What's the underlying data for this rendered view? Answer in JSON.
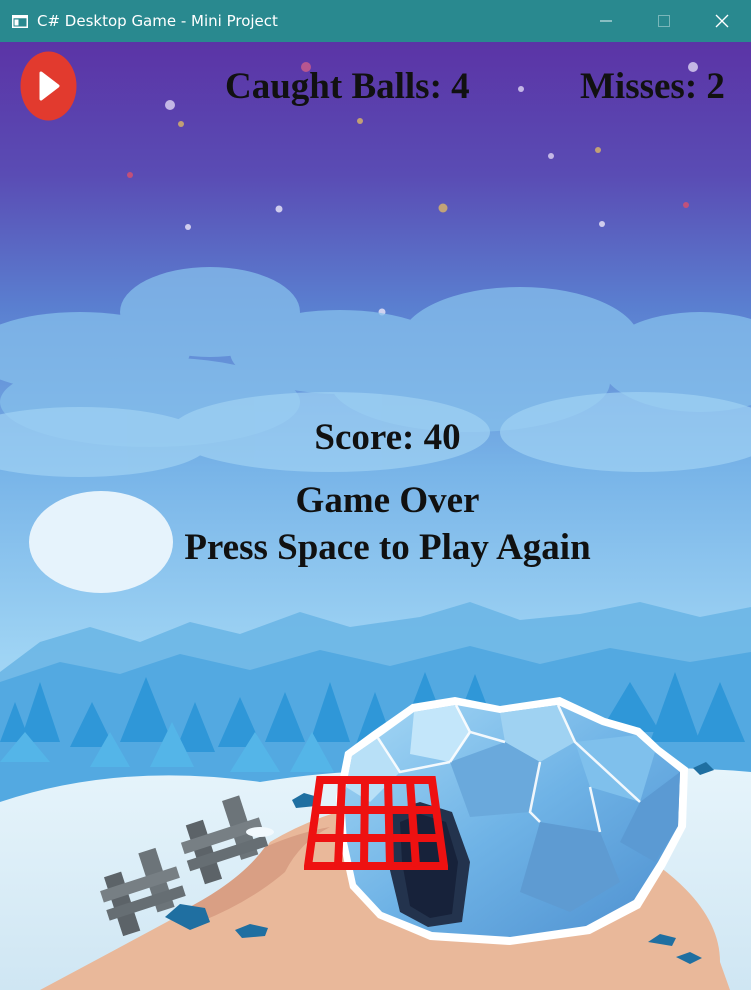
{
  "window": {
    "title": "C# Desktop Game - Mini Project",
    "titlebar_color": "#29898f",
    "controls": [
      "minimize-icon",
      "maximize-icon",
      "close-icon"
    ]
  },
  "hud": {
    "caught_balls_text": "Caught Balls: 4",
    "misses_text": "Misses: 2",
    "play_button_icon": "play-icon",
    "play_button_color": "#e23a2e"
  },
  "game_over": {
    "score_text": "Score: 40",
    "title_text": "Game Over",
    "prompt_text": "Press Space to Play Again"
  },
  "basket": {
    "icon": "basket-icon",
    "color": "#ee1111"
  }
}
